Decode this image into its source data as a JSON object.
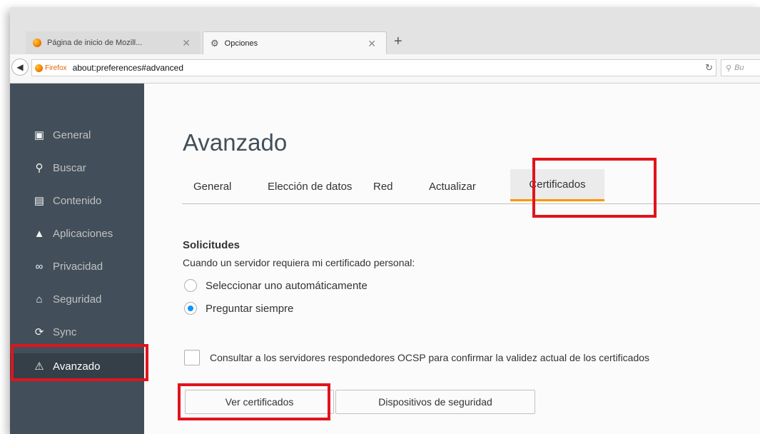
{
  "browser": {
    "tabs": [
      {
        "title": "Página de inicio de Mozill...",
        "icon": "firefox-icon",
        "active": false
      },
      {
        "title": "Opciones",
        "icon": "gear-icon",
        "active": true
      }
    ],
    "new_tab_label": "+",
    "identity_label": "Firefox",
    "url": "about:preferences#advanced",
    "search_placeholder": "Bu"
  },
  "sidebar": {
    "items": [
      {
        "label": "General",
        "icon": "general-icon"
      },
      {
        "label": "Buscar",
        "icon": "search-icon"
      },
      {
        "label": "Contenido",
        "icon": "document-icon"
      },
      {
        "label": "Aplicaciones",
        "icon": "rocket-icon"
      },
      {
        "label": "Privacidad",
        "icon": "mask-icon"
      },
      {
        "label": "Seguridad",
        "icon": "lock-icon"
      },
      {
        "label": "Sync",
        "icon": "sync-icon"
      },
      {
        "label": "Avanzado",
        "icon": "advanced-icon",
        "selected": true
      }
    ]
  },
  "main": {
    "title": "Avanzado",
    "tabs": [
      "General",
      "Elección de datos",
      "Red",
      "Actualizar",
      "Certificados"
    ],
    "selected_tab": "Certificados",
    "section": {
      "title": "Solicitudes",
      "description": "Cuando un servidor requiera mi certificado personal:",
      "options": [
        {
          "label": "Seleccionar uno automáticamente",
          "checked": false
        },
        {
          "label": "Preguntar siempre",
          "checked": true
        }
      ],
      "ocsp_label": "Consultar a los servidores respondedores OCSP para confirmar la validez actual de los certificados",
      "ocsp_checked": false
    },
    "buttons": {
      "view_certificates": "Ver certificados",
      "security_devices": "Dispositivos de seguridad"
    }
  },
  "colors": {
    "sidebar_bg": "#424f5a",
    "accent_orange": "#ff9500",
    "radio_blue": "#0996f8",
    "highlight_red": "#e0141c"
  }
}
